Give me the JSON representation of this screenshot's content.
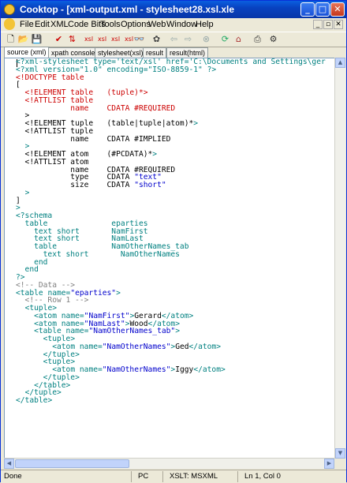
{
  "window": {
    "title": "Cooktop - [xml-output.xml - stylesheet28.xsl.xle"
  },
  "menu": [
    "File",
    "Edit",
    "XML",
    "Code Bits",
    "Tools",
    "Options",
    "Web",
    "Window",
    "Help"
  ],
  "tabs": [
    "source (xml)",
    "xpath console",
    "stylesheet(xsl)",
    "result",
    "result(html)"
  ],
  "status": {
    "left": "Done",
    "mode": "PC",
    "xslt": "XSLT: MSXML",
    "position": "Ln 1, Col 0"
  },
  "icons": {
    "new": "new-file-icon",
    "open": "open-folder-icon",
    "save": "save-icon",
    "check": "check-icon",
    "xslt": "xslt-icon",
    "binoculars": "find-icon",
    "back": "back-arrow-icon",
    "forward": "forward-arrow-icon",
    "stop": "stop-icon",
    "refresh": "refresh-icon",
    "home": "home-icon",
    "print": "print-icon",
    "settings": "settings-icon"
  },
  "code_lines": [
    "<?xml-stylesheet type='text/xsl' href='C:\\Documents and Settings\\ger",
    "<?xml version=\"1.0\" encoding=\"ISO-8859-1\" ?>",
    "<!DOCTYPE table",
    "[",
    "  <!ELEMENT table   (tuple)*>",
    "  <!ATTLIST table",
    "            name    CDATA #REQUIRED",
    "  >",
    "",
    "  <!ELEMENT tuple   (table|tuple|atom)*>",
    "  <!ATTLIST tuple",
    "            name    CDATA #IMPLIED",
    "  >",
    "",
    "  <!ELEMENT atom    (#PCDATA)*>",
    "  <!ATTLIST atom",
    "            name    CDATA #REQUIRED",
    "            type    CDATA \"text\"",
    "            size    CDATA \"short\"",
    "  >",
    "]",
    ">",
    "<?schema",
    "  table              eparties",
    "    text short       NamFirst",
    "    text short       NamLast",
    "    table            NamOtherNames_tab",
    "      text short       NamOtherNames",
    "    end",
    "  end",
    "?>",
    "<!-- Data -->",
    "<table name=\"eparties\">",
    "",
    "  <!-- Row 1 -->",
    "  <tuple>",
    "    <atom name=\"NamFirst\">Gerard</atom>",
    "    <atom name=\"NamLast\">Wood</atom>",
    "    <table name=\"NamOtherNames_tab\">",
    "      <tuple>",
    "        <atom name=\"NamOtherNames\">Ged</atom>",
    "      </tuple>",
    "      <tuple>",
    "        <atom name=\"NamOtherNames\">Iggy</atom>",
    "      </tuple>",
    "    </table>",
    "  </tuple>",
    "</table>"
  ],
  "colors": {
    "tag": "#008080",
    "dtd": "#cc0000",
    "text": "#000000",
    "comment": "#808080",
    "value": "#0000cc"
  }
}
